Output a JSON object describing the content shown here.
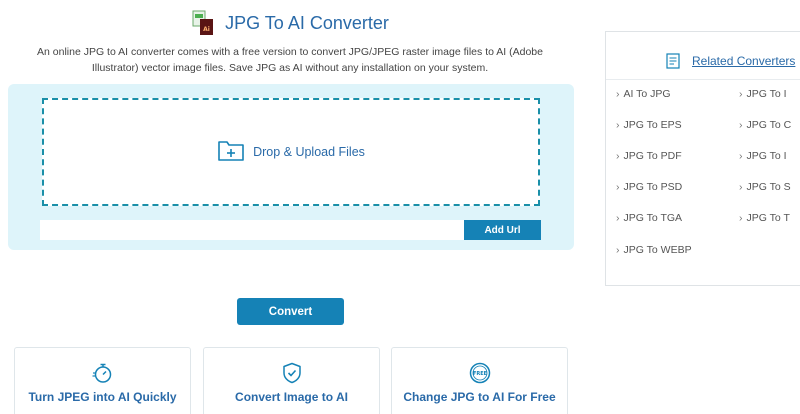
{
  "header": {
    "title": "JPG To AI Converter",
    "description": "An online JPG to AI converter comes with a free version to convert JPG/JPEG raster image files to AI (Adobe Illustrator) vector image files. Save JPG as AI without any installation on your system."
  },
  "upload": {
    "drop_label": "Drop & Upload Files",
    "url_value": "",
    "add_url_label": "Add Url"
  },
  "convert_label": "Convert",
  "features": [
    {
      "title": "Turn JPEG into AI Quickly",
      "icon": "stopwatch-icon"
    },
    {
      "title": "Convert Image to AI",
      "icon": "shield-check-icon"
    },
    {
      "title": "Change JPG to AI For Free",
      "icon": "free-badge-icon"
    }
  ],
  "related": {
    "title": "Related Converters",
    "left_links": [
      "AI To JPG",
      "JPG To EPS",
      "JPG To PDF",
      "JPG To PSD",
      "JPG To TGA",
      "JPG To WEBP"
    ],
    "right_links": [
      "JPG To I",
      "JPG To C",
      "JPG To I",
      "JPG To S",
      "JPG To T"
    ]
  },
  "colors": {
    "accent": "#1582b6",
    "title": "#2a6aa8",
    "panel": "#def4fa"
  }
}
